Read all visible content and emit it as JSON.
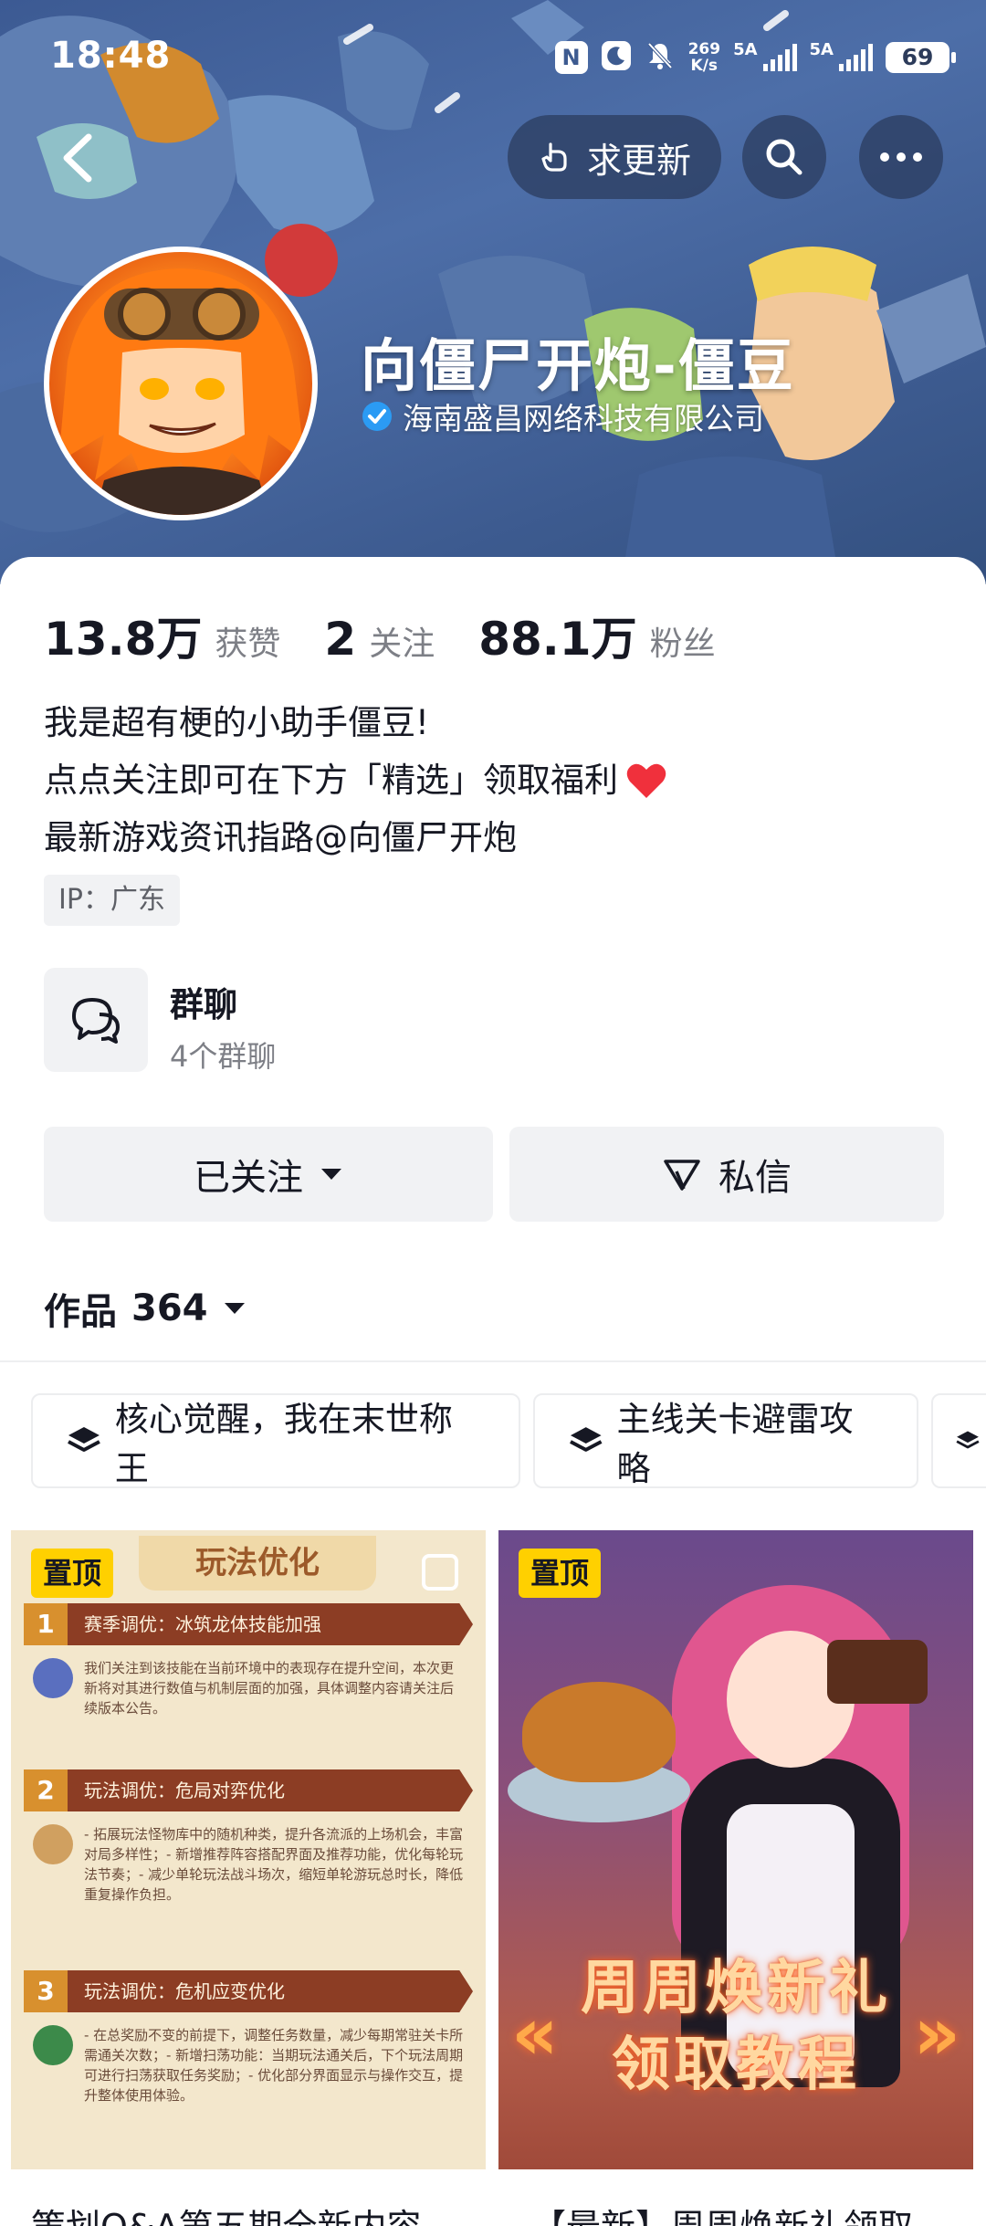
{
  "status_bar": {
    "time": "18:48",
    "net_speed_value": "269",
    "net_speed_unit": "K/s",
    "sim1": "5A",
    "sim2": "5A",
    "battery": "69"
  },
  "header": {
    "request_update_label": "求更新",
    "profile_name": "向僵尸开炮-僵豆",
    "verified_org": "海南盛昌网络科技有限公司"
  },
  "stats": [
    {
      "value": "13.8万",
      "label": "获赞"
    },
    {
      "value": "2",
      "label": "关注"
    },
    {
      "value": "88.1万",
      "label": "粉丝"
    }
  ],
  "bio": {
    "line1": "我是超有梗的小助手僵豆!",
    "line2": "点点关注即可在下方「精选」领取福利",
    "line3": "最新游戏资讯指路@向僵尸开炮",
    "ip": "IP：广东"
  },
  "group_chat": {
    "title": "群聊",
    "subtitle": "4个群聊"
  },
  "actions": {
    "follow_label": "已关注",
    "message_label": "私信"
  },
  "works": {
    "label": "作品",
    "count": "364"
  },
  "collections": [
    {
      "label": "核心觉醒，我在末世称王"
    },
    {
      "label": "主线关卡避雷攻略"
    }
  ],
  "posts": [
    {
      "pin_label": "置顶",
      "caption": "策划Q&A第五期全新内容",
      "poster": {
        "title": "玩法优化",
        "sections": [
          {
            "num": "1",
            "heading": "赛季调优：冰筑龙体技能加强",
            "body": "我们关注到该技能在当前环境中的表现存在提升空间，本次更新将对其进行数值与机制层面的加强，具体调整内容请关注后续版本公告。"
          },
          {
            "num": "2",
            "heading": "玩法调优：危局对弈优化",
            "body": "- 拓展玩法怪物库中的随机种类，提升各流派的上场机会，丰富对局多样性；- 新增推荐阵容搭配界面及推荐功能，优化每轮玩法节奏；- 减少单轮玩法战斗场次，缩短单轮游玩总时长，降低重复操作负担。"
          },
          {
            "num": "3",
            "heading": "玩法调优：危机应变优化",
            "body": "- 在总奖励不变的前提下，调整任务数量，减少每期常驻关卡所需通关次数；- 新增扫荡功能：当期玩法通关后，下个玩法周期可进行扫荡获取任务奖励；- 优化部分界面显示与操作交互，提升整体使用体验。"
          }
        ]
      }
    },
    {
      "pin_label": "置顶",
      "caption": "【最新】周周焕新礼领取",
      "poster": {
        "line1": "周周焕新礼",
        "line2": "领取教程"
      }
    }
  ]
}
